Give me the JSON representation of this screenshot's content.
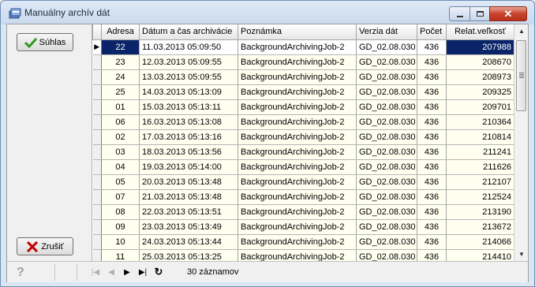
{
  "window": {
    "title": "Manuálny archív dát"
  },
  "buttons": {
    "ok_label": "Súhlas",
    "cancel_label": "Zrušiť"
  },
  "table": {
    "headers": [
      "Adresa",
      "Dátum a čas archivácie",
      "Poznámka",
      "Verzia dát",
      "Počet",
      "Relat.veľkosť"
    ],
    "selected_row": 0,
    "rows": [
      [
        "22",
        "11.03.2013 05:09:50",
        "BackgroundArchivingJob-2",
        "GD_02.08.030",
        "436",
        "207988"
      ],
      [
        "23",
        "12.03.2013 05:09:55",
        "BackgroundArchivingJob-2",
        "GD_02.08.030",
        "436",
        "208670"
      ],
      [
        "24",
        "13.03.2013 05:09:55",
        "BackgroundArchivingJob-2",
        "GD_02.08.030",
        "436",
        "208973"
      ],
      [
        "25",
        "14.03.2013 05:13:09",
        "BackgroundArchivingJob-2",
        "GD_02.08.030",
        "436",
        "209325"
      ],
      [
        "01",
        "15.03.2013 05:13:11",
        "BackgroundArchivingJob-2",
        "GD_02.08.030",
        "436",
        "209701"
      ],
      [
        "06",
        "16.03.2013 05:13:08",
        "BackgroundArchivingJob-2",
        "GD_02.08.030",
        "436",
        "210364"
      ],
      [
        "02",
        "17.03.2013 05:13:16",
        "BackgroundArchivingJob-2",
        "GD_02.08.030",
        "436",
        "210814"
      ],
      [
        "03",
        "18.03.2013 05:13:56",
        "BackgroundArchivingJob-2",
        "GD_02.08.030",
        "436",
        "211241"
      ],
      [
        "04",
        "19.03.2013 05:14:00",
        "BackgroundArchivingJob-2",
        "GD_02.08.030",
        "436",
        "211626"
      ],
      [
        "05",
        "20.03.2013 05:13:48",
        "BackgroundArchivingJob-2",
        "GD_02.08.030",
        "436",
        "212107"
      ],
      [
        "07",
        "21.03.2013 05:13:48",
        "BackgroundArchivingJob-2",
        "GD_02.08.030",
        "436",
        "212524"
      ],
      [
        "08",
        "22.03.2013 05:13:51",
        "BackgroundArchivingJob-2",
        "GD_02.08.030",
        "436",
        "213190"
      ],
      [
        "09",
        "23.03.2013 05:13:49",
        "BackgroundArchivingJob-2",
        "GD_02.08.030",
        "436",
        "213672"
      ],
      [
        "10",
        "24.03.2013 05:13:44",
        "BackgroundArchivingJob-2",
        "GD_02.08.030",
        "436",
        "214066"
      ],
      [
        "11",
        "25.03.2013 05:13:25",
        "BackgroundArchivingJob-2",
        "GD_02.08.030",
        "436",
        "214410"
      ]
    ]
  },
  "status": {
    "record_count": "30 záznamov"
  },
  "icons": {
    "title": "archive-icon",
    "ok": "checkmark-icon",
    "cancel": "x-mark-icon",
    "help": "help-icon",
    "first": "first-record-icon",
    "prev": "previous-record-icon",
    "next": "next-record-icon",
    "last": "last-record-icon",
    "refresh": "refresh-icon"
  },
  "colors": {
    "selection": "#0a246a",
    "row_background": "#fffff0",
    "ok_icon": "#2e9a1e",
    "cancel_icon": "#c00000"
  }
}
